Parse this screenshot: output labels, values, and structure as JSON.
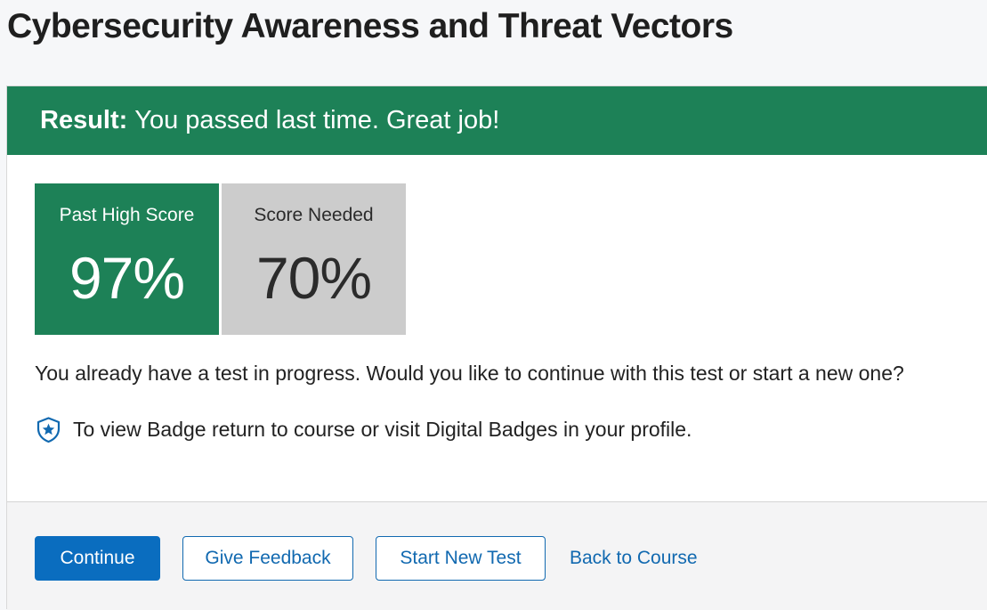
{
  "page": {
    "title": "Cybersecurity Awareness and Threat Vectors"
  },
  "result": {
    "label": "Result:",
    "message": "You passed last time. Great job!"
  },
  "scores": {
    "past_high": {
      "caption": "Past High Score",
      "value": "97%"
    },
    "needed": {
      "caption": "Score Needed",
      "value": "70%"
    }
  },
  "progress_message": "You already have a test in progress. Would you like to continue with this test or start a new one?",
  "badge_note": {
    "icon": "badge-shield-star-icon",
    "text": "To view Badge return to course or visit Digital Badges in your profile."
  },
  "actions": {
    "continue_label": "Continue",
    "feedback_label": "Give Feedback",
    "new_test_label": "Start New Test",
    "back_label": "Back to Course"
  },
  "colors": {
    "success_green": "#1d8157",
    "neutral_gray": "#cccccc",
    "primary_blue": "#0a6dbf",
    "link_blue": "#1169b0"
  }
}
